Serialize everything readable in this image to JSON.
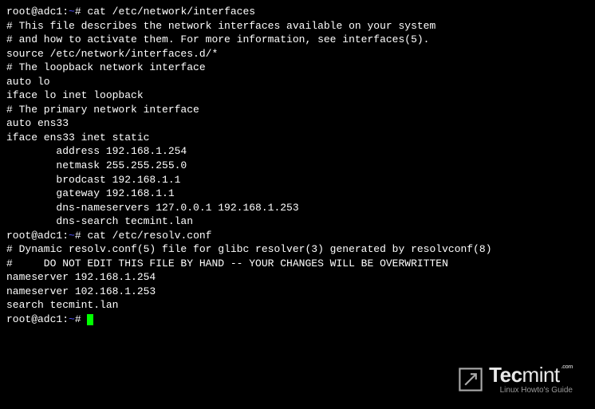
{
  "prompt1": {
    "user_host": "root@adc1",
    "colon": ":",
    "path": "~",
    "hash": "# ",
    "command": "cat /etc/network/interfaces"
  },
  "file1": {
    "l1": "# This file describes the network interfaces available on your system",
    "l2": "# and how to activate them. For more information, see interfaces(5).",
    "l3": "",
    "l4": "source /etc/network/interfaces.d/*",
    "l5": "",
    "l6": "# The loopback network interface",
    "l7": "auto lo",
    "l8": "iface lo inet loopback",
    "l9": "",
    "l10": "# The primary network interface",
    "l11": "auto ens33",
    "l12": "iface ens33 inet static",
    "l13": "        address 192.168.1.254",
    "l14": "        netmask 255.255.255.0",
    "l15": "        brodcast 192.168.1.1",
    "l16": "        gateway 192.168.1.1",
    "l17": "        dns-nameservers 127.0.0.1 192.168.1.253",
    "l18": "        dns-search tecmint.lan"
  },
  "prompt2": {
    "user_host": "root@adc1",
    "colon": ":",
    "path": "~",
    "hash": "# ",
    "command": "cat /etc/resolv.conf"
  },
  "file2": {
    "l1": "# Dynamic resolv.conf(5) file for glibc resolver(3) generated by resolvconf(8)",
    "l2": "#     DO NOT EDIT THIS FILE BY HAND -- YOUR CHANGES WILL BE OVERWRITTEN",
    "l3": "nameserver 192.168.1.254",
    "l4": "nameserver 102.168.1.253",
    "l5": "search tecmint.lan"
  },
  "prompt3": {
    "user_host": "root@adc1",
    "colon": ":",
    "path": "~",
    "hash": "# "
  },
  "watermark": {
    "brand_tec": "Tec",
    "brand_mint": "mint",
    "dotcom": ".com",
    "tagline": "Linux Howto's Guide"
  }
}
